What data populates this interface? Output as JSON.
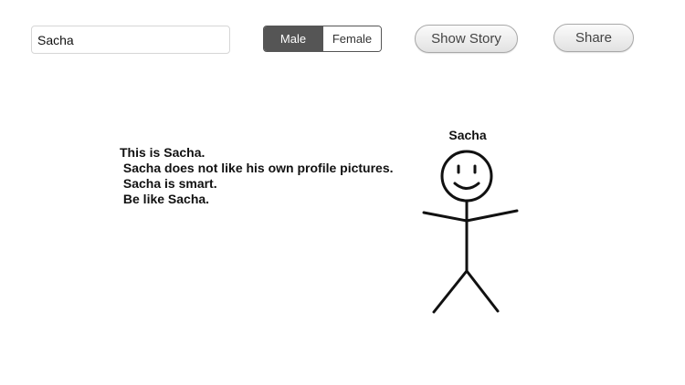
{
  "form": {
    "name_value": "Sacha"
  },
  "gender": {
    "options": [
      "Male",
      "Female"
    ],
    "selected": "Male"
  },
  "buttons": {
    "show_story": "Show Story",
    "share": "Share"
  },
  "story": {
    "lines": [
      "This is Sacha.",
      " Sacha does not like his own profile pictures.",
      " Sacha is smart.",
      " Be like Sacha."
    ]
  },
  "figure": {
    "name": "Sacha",
    "icon": "stick-figure-icon"
  }
}
